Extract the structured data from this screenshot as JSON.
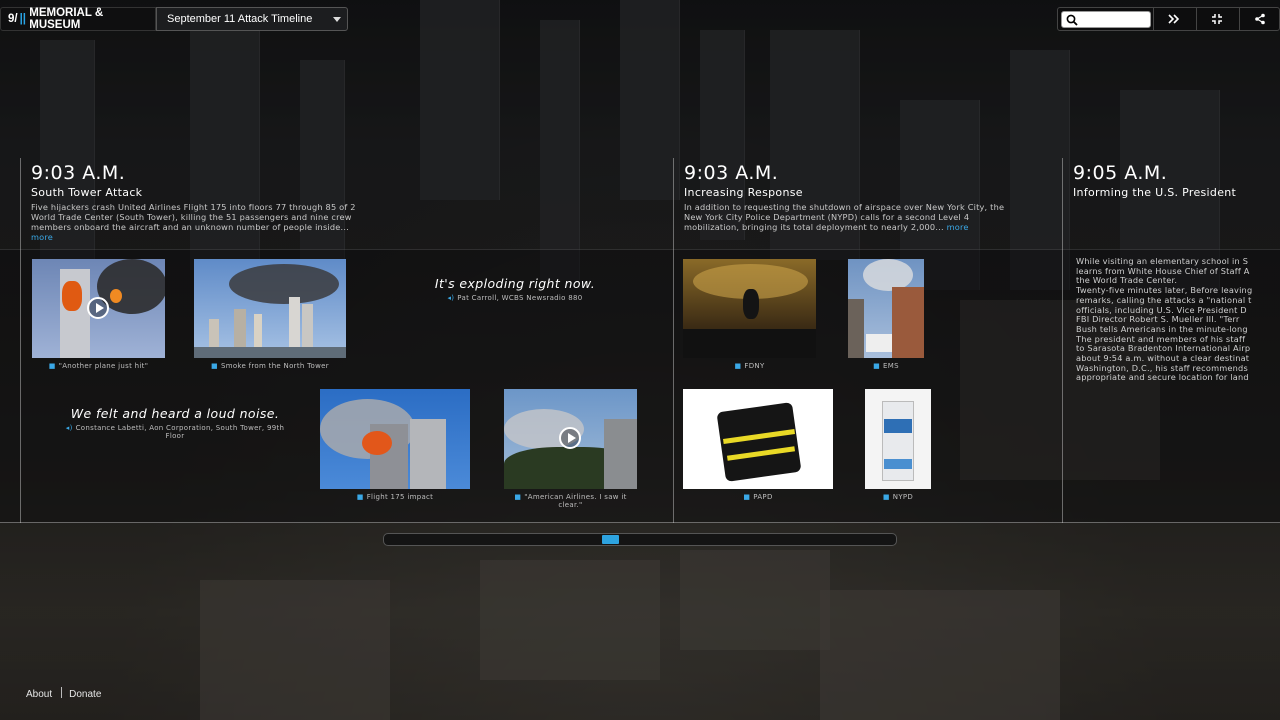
{
  "header": {
    "logo_prefix": "9/",
    "logo_bars": "||",
    "logo_text": "MEMORIAL & MUSEUM",
    "timeline_select": "September 11 Attack Timeline"
  },
  "toolbar": {
    "search_placeholder": "",
    "icons": [
      "search-icon",
      "fast-forward-icon",
      "fullscreen-icon",
      "share-icon"
    ]
  },
  "entries": [
    {
      "time": "9:03 A.M.",
      "title": "South Tower Attack",
      "desc_lines": [
        "Five hijackers crash United Airlines Flight 175 into floors 77 through 85 of 2",
        "World Trade Center (South Tower), killing the 51 passengers and nine crew",
        "members onboard the aircraft and an unknown number of people inside..."
      ],
      "more": "more"
    },
    {
      "time": "9:03 A.M.",
      "title": "Increasing Response",
      "desc_lines": [
        "In addition to requesting the shutdown of airspace over New York City, the",
        "New York City Police Department (NYPD) calls for a second Level 4",
        "mobilization, bringing its total deployment to nearly 2,000..."
      ],
      "more": "more"
    },
    {
      "time": "9:05 A.M.",
      "title": "Informing the U.S. President",
      "body_lines": [
        "While visiting an elementary school in S",
        "learns from White House Chief of Staff A",
        "the World Trade Center.",
        "Twenty-five minutes later, Before leaving",
        "remarks, calling the attacks a \"national t",
        "officials, including U.S. Vice President D",
        "FBI Director Robert S. Mueller III. \"Terr",
        "Bush tells Americans in the minute-long",
        "The president and members of his staff",
        "to Sarasota Bradenton International Airp",
        "about 9:54 a.m. without a clear destinat",
        "Washington, D.C., his staff recommends",
        "appropriate and secure location for land"
      ]
    }
  ],
  "media": {
    "another_plane": "\"Another plane just hit\"",
    "smoke_north": "Smoke from the North Tower",
    "flight175": "Flight 175 impact",
    "american": "\"American Airlines. I saw it clear.\"",
    "fdny": "FDNY",
    "ems": "EMS",
    "papd": "PAPD",
    "nypd": "NYPD"
  },
  "quotes": {
    "q1_text": "It's exploding right now.",
    "q1_src": "Pat Carroll, WCBS Newsradio 880",
    "q2_text": "We felt and heard a loud noise.",
    "q2_src_line1": "Constance Labetti, Aon Corporation, South Tower, 99th",
    "q2_src_line2": "Floor"
  },
  "scroller": {
    "position": 0.44
  },
  "footer": {
    "about": "About",
    "donate": "Donate"
  },
  "colors": {
    "accent": "#2da3e0",
    "background": "#1a1a1a"
  }
}
